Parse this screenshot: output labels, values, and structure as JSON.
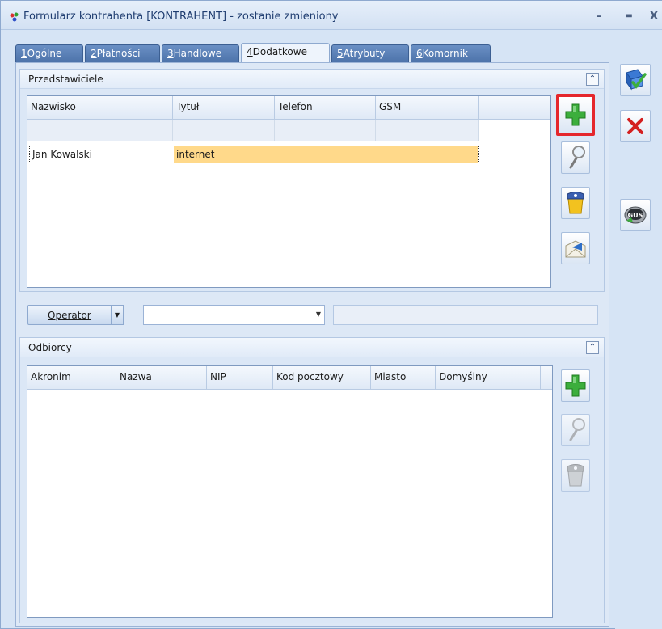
{
  "window": {
    "title": "Formularz kontrahenta [KONTRAHENT] - zostanie zmieniony",
    "minimize_glyph": "–",
    "maximize_glyph": "▬",
    "close_glyph": "X"
  },
  "tabs": [
    {
      "number": "1",
      "label": "Ogólne",
      "active": false
    },
    {
      "number": "2",
      "label": "Płatności",
      "active": false
    },
    {
      "number": "3",
      "label": "Handlowe",
      "active": false
    },
    {
      "number": "4",
      "label": "Dodatkowe",
      "active": true
    },
    {
      "number": "5",
      "label": "Atrybuty",
      "active": false
    },
    {
      "number": "6",
      "label": "Komornik",
      "active": false
    }
  ],
  "representatives": {
    "title": "Przedstawiciele",
    "columns": [
      "Nazwisko",
      "Tytuł",
      "Telefon",
      "GSM"
    ],
    "rows": [
      {
        "nazwisko": "Jan Kowalski",
        "tytul": "internet",
        "telefon": "",
        "gsm": ""
      }
    ],
    "buttons": {
      "add_icon": "plus-icon",
      "edit_icon": "magnifier-icon",
      "delete_icon": "trash-icon",
      "send_icon": "envelope-icon"
    }
  },
  "operator": {
    "button_label": "Operator",
    "combo_value": "",
    "text_value": ""
  },
  "recipients": {
    "title": "Odbiorcy",
    "columns": [
      "Akronim",
      "Nazwa",
      "NIP",
      "Kod pocztowy",
      "Miasto",
      "Domyślny"
    ],
    "rows": []
  },
  "actions": {
    "save_icon": "save-icon",
    "cancel_icon": "cancel-icon",
    "gus_label": "GUS"
  },
  "colors": {
    "accent_tab": "#4d73aa",
    "highlight_border": "#e5272c",
    "selected_row": "#ffd98a",
    "add_green": "#3cae3c"
  }
}
